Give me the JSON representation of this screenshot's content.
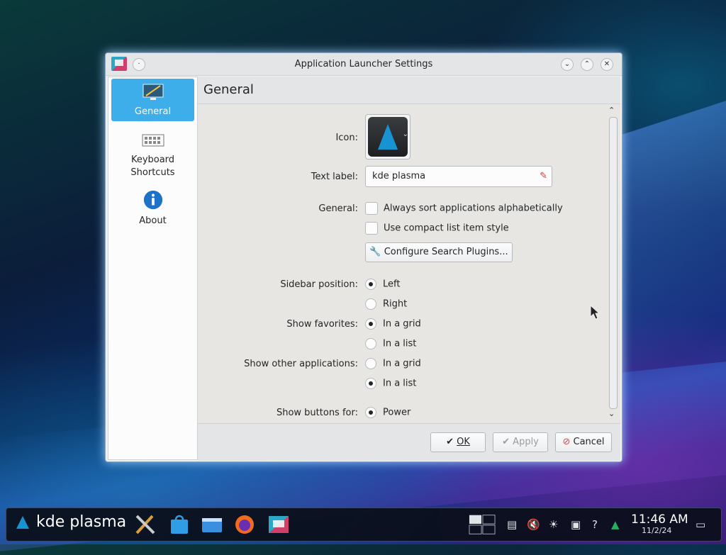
{
  "window": {
    "title": "Application Launcher Settings",
    "header": "General"
  },
  "sidebar": {
    "items": [
      {
        "label": "General",
        "icon": "desktop-icon"
      },
      {
        "label": "Keyboard",
        "label2": "Shortcuts",
        "icon": "keyboard-icon"
      },
      {
        "label": "About",
        "icon": "info-icon"
      }
    ]
  },
  "form": {
    "icon_label": "Icon:",
    "text_label_label": "Text label:",
    "text_label_value": "kde plasma",
    "general_label": "General:",
    "sort_alpha": "Always sort applications alphabetically",
    "compact_list": "Use compact list item style",
    "configure_search": "Configure Search Plugins...",
    "sidebar_position_label": "Sidebar position:",
    "left": "Left",
    "right": "Right",
    "show_favorites_label": "Show favorites:",
    "fav_grid": "In a grid",
    "fav_list": "In a list",
    "show_other_label": "Show other applications:",
    "other_grid": "In a grid",
    "other_list": "In a list",
    "show_buttons_label": "Show buttons for:",
    "power": "Power"
  },
  "buttons": {
    "ok": "OK",
    "apply": "Apply",
    "cancel": "Cancel"
  },
  "taskbar": {
    "launcher_label": "kde plasma",
    "time": "11:46 AM",
    "date": "11/2/24"
  },
  "colors": {
    "accent": "#3daee9",
    "arch_blue": "#1793d1",
    "cancel_red": "#da4453"
  }
}
